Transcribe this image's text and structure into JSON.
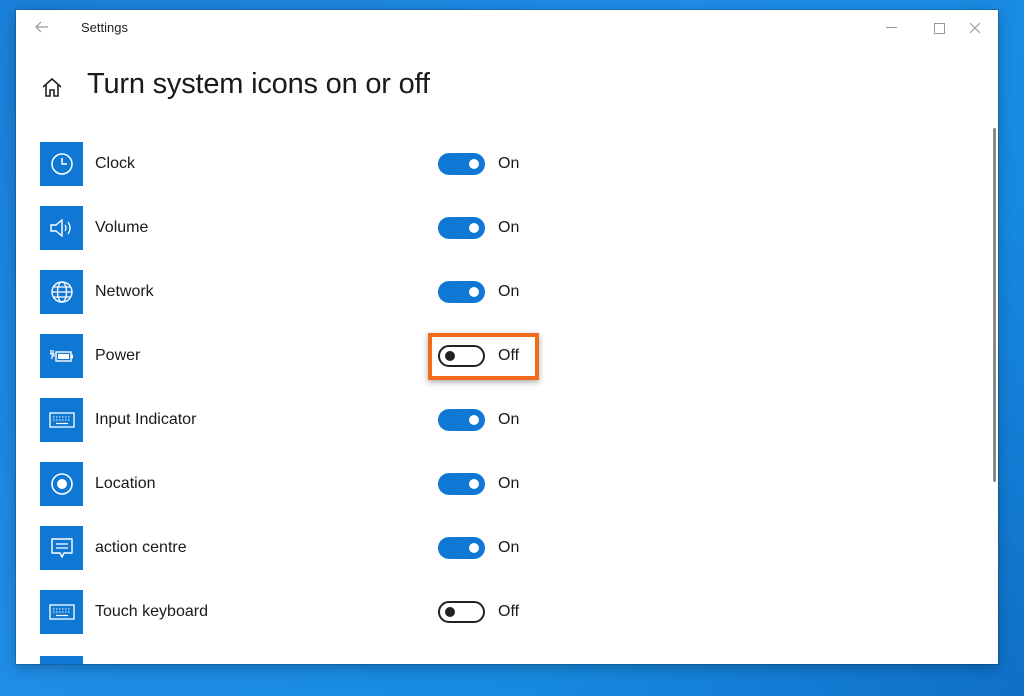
{
  "window": {
    "title": "Settings",
    "controls": [
      "minimize",
      "maximize",
      "close"
    ]
  },
  "page": {
    "title": "Turn system icons on or off"
  },
  "colors": {
    "accent": "#0f78d4",
    "highlight": "#f26b1d"
  },
  "items": [
    {
      "label": "Clock",
      "state": "On",
      "on": true,
      "icon": "clock-icon"
    },
    {
      "label": "Volume",
      "state": "On",
      "on": true,
      "icon": "volume-icon"
    },
    {
      "label": "Network",
      "state": "On",
      "on": true,
      "icon": "network-globe-icon"
    },
    {
      "label": "Power",
      "state": "Off",
      "on": false,
      "icon": "battery-icon"
    },
    {
      "label": "Input Indicator",
      "state": "On",
      "on": true,
      "icon": "keyboard-icon"
    },
    {
      "label": "Location",
      "state": "On",
      "on": true,
      "icon": "location-icon"
    },
    {
      "label": "action centre",
      "state": "On",
      "on": true,
      "icon": "action-centre-icon"
    },
    {
      "label": "Touch keyboard",
      "state": "Off",
      "on": false,
      "icon": "keyboard-icon"
    }
  ]
}
